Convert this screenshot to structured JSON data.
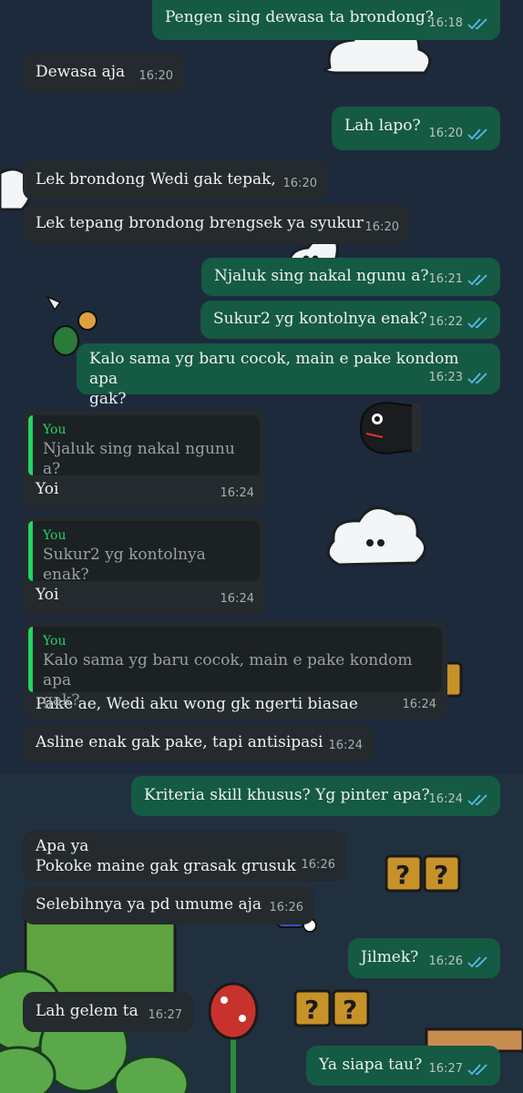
{
  "colors": {
    "outgoing_bubble": "#155a43",
    "incoming_bubble": "#242a2d",
    "read_ticks": "#53bdeb",
    "quote_accent": "#25d366",
    "wallpaper": "#1d2a3c"
  },
  "icons": {
    "read_receipt": "double-check-icon"
  },
  "messages": [
    {
      "dir": "out",
      "text": "Pengen sing dewasa ta brondong?",
      "time": "16:18"
    },
    {
      "dir": "in",
      "text": "Dewasa aja",
      "time": "16:20"
    },
    {
      "dir": "out",
      "text": "Lah lapo?",
      "time": "16:20"
    },
    {
      "dir": "in",
      "text": "Lek brondong Wedi gak tepak,",
      "time": "16:20"
    },
    {
      "dir": "in",
      "text": "Lek tepang brondong brengsek ya syukur",
      "time": "16:20"
    },
    {
      "dir": "out",
      "text": "Njaluk sing nakal ngunu a?",
      "time": "16:21"
    },
    {
      "dir": "out",
      "text": "Sukur2 yg kontolnya enak?",
      "time": "16:22"
    },
    {
      "dir": "out",
      "text": "Kalo sama yg baru cocok, main e pake kondom apa\ngak?",
      "time": "16:23"
    },
    {
      "dir": "in",
      "quote_name": "You",
      "quote_text": "Njaluk sing nakal ngunu a?",
      "text": "Yoi",
      "time": "16:24"
    },
    {
      "dir": "in",
      "quote_name": "You",
      "quote_text": "Sukur2 yg kontolnya enak?",
      "text": "Yoi",
      "time": "16:24"
    },
    {
      "dir": "in",
      "quote_name": "You",
      "quote_text": "Kalo sama yg baru cocok, main e pake kondom apa\ngak?",
      "text": "Pake ae, Wedi aku wong gk ngerti biasae",
      "time": "16:24"
    },
    {
      "dir": "in",
      "text": "Asline enak gak pake, tapi antisipasi",
      "time": "16:24"
    },
    {
      "dir": "out",
      "text": "Kriteria skill khusus? Yg pinter apa?",
      "time": "16:24"
    },
    {
      "dir": "in",
      "text": "Apa ya\nPokoke maine gak grasak grusuk",
      "time": "16:26"
    },
    {
      "dir": "in",
      "text": "Selebihnya ya pd umume aja",
      "time": "16:26"
    },
    {
      "dir": "out",
      "text": "Jilmek?",
      "time": "16:26"
    },
    {
      "dir": "in",
      "text": "Lah gelem ta",
      "time": "16:27"
    },
    {
      "dir": "out",
      "text": "Ya siapa tau?",
      "time": "16:27"
    }
  ]
}
